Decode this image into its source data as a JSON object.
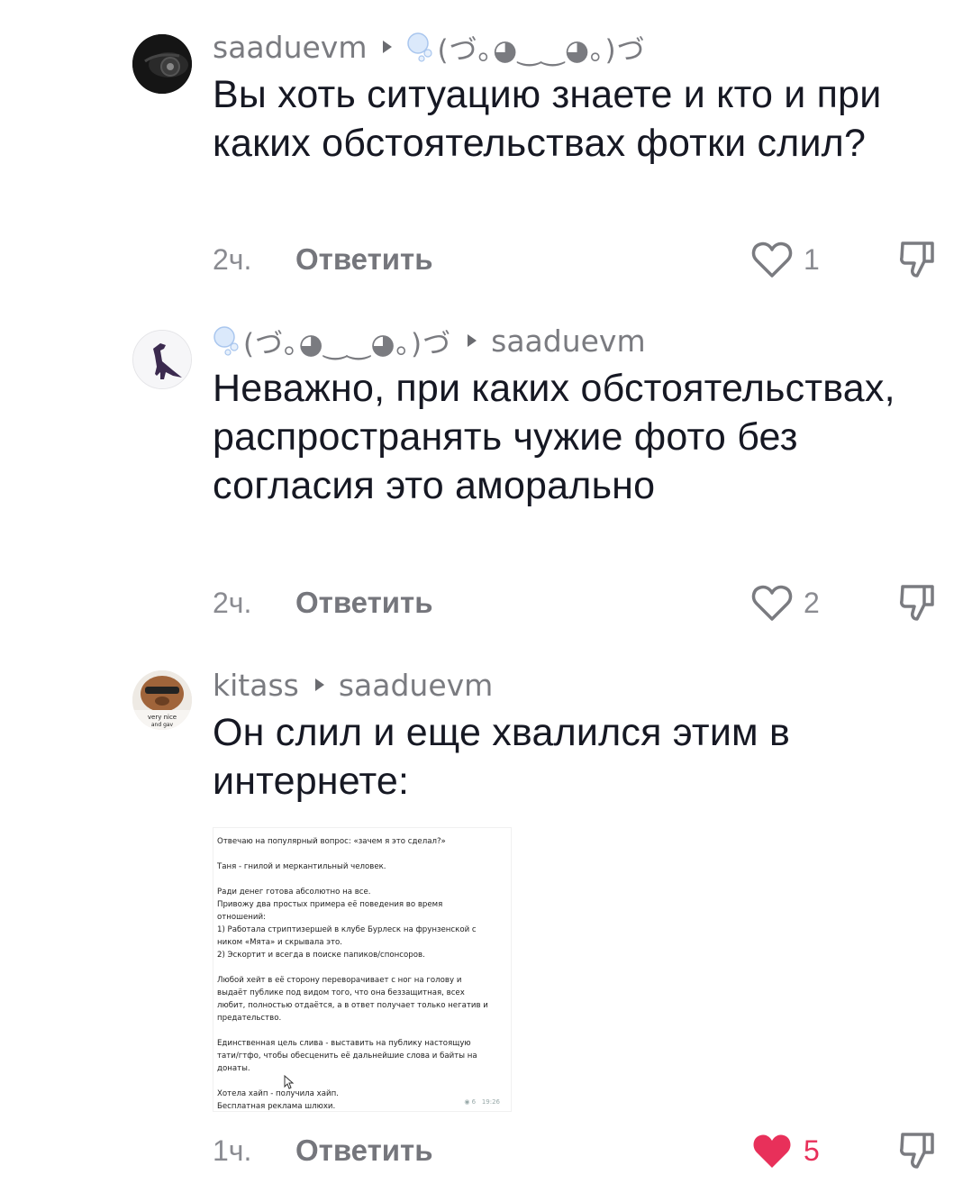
{
  "comments": [
    {
      "author": "saaduevm",
      "reply_to": "(づ｡◕‿‿◕｡)づ",
      "text": "Вы хоть ситуацию знаете и кто и при каких обстоятельствах фотки слил?",
      "time": "2ч.",
      "reply_label": "Ответить",
      "likes": "1",
      "liked": false,
      "avatar_icon": "car-avatar"
    },
    {
      "author": "(づ｡◕‿‿◕｡)づ",
      "reply_to": "saaduevm",
      "text": "Неважно, при каких обстоятельствах, распространять чужие фото без согласия это аморально",
      "time": "2ч.",
      "reply_label": "Ответить",
      "likes": "2",
      "liked": false,
      "avatar_icon": "dinosaur-avatar"
    },
    {
      "author": "kitass",
      "reply_to": "saaduevm",
      "text": "Он слил и еще хвалился этим в интернете:",
      "time": "1ч.",
      "reply_label": "Ответить",
      "likes": "5",
      "liked": true,
      "avatar_icon": "dog-avatar",
      "avatar_caption": "very nice and gav"
    }
  ],
  "attachment": {
    "lines": [
      "Отвечаю на популярный вопрос: «зачем я это сделал?»",
      "",
      "Таня - гнилой и меркантильный человек.",
      "",
      "Ради денег готова абсолютно на все.",
      "Привожу два простых примера её поведения во время",
      "отношений:",
      "1) Работала стриптизершей в клубе Бурлеск на фрунзенской с",
      "ником «Мята» и скрывала это.",
      "2) Эскортит и всегда в поиске папиков/спонсоров.",
      "",
      "Любой хейт в её сторону переворачивает с ног на голову и",
      "выдаёт публике под видом того, что она беззащитная, всех",
      "любит, полностью отдаётся, а в ответ получает только негатив и",
      "предательство.",
      "",
      "Единственная цель слива - выставить на публику настоящую",
      "тати/гтфо, чтобы обесценить её дальнейшие слова и байты на",
      "донаты.",
      "",
      "Хотела хайп - получила хайп.",
      "Бесплатная реклама шлюхи."
    ],
    "views": "6",
    "time": "19:26"
  },
  "colors": {
    "like_active": "#e8305a",
    "text_primary": "#161823",
    "text_secondary": "#8a8b91"
  }
}
